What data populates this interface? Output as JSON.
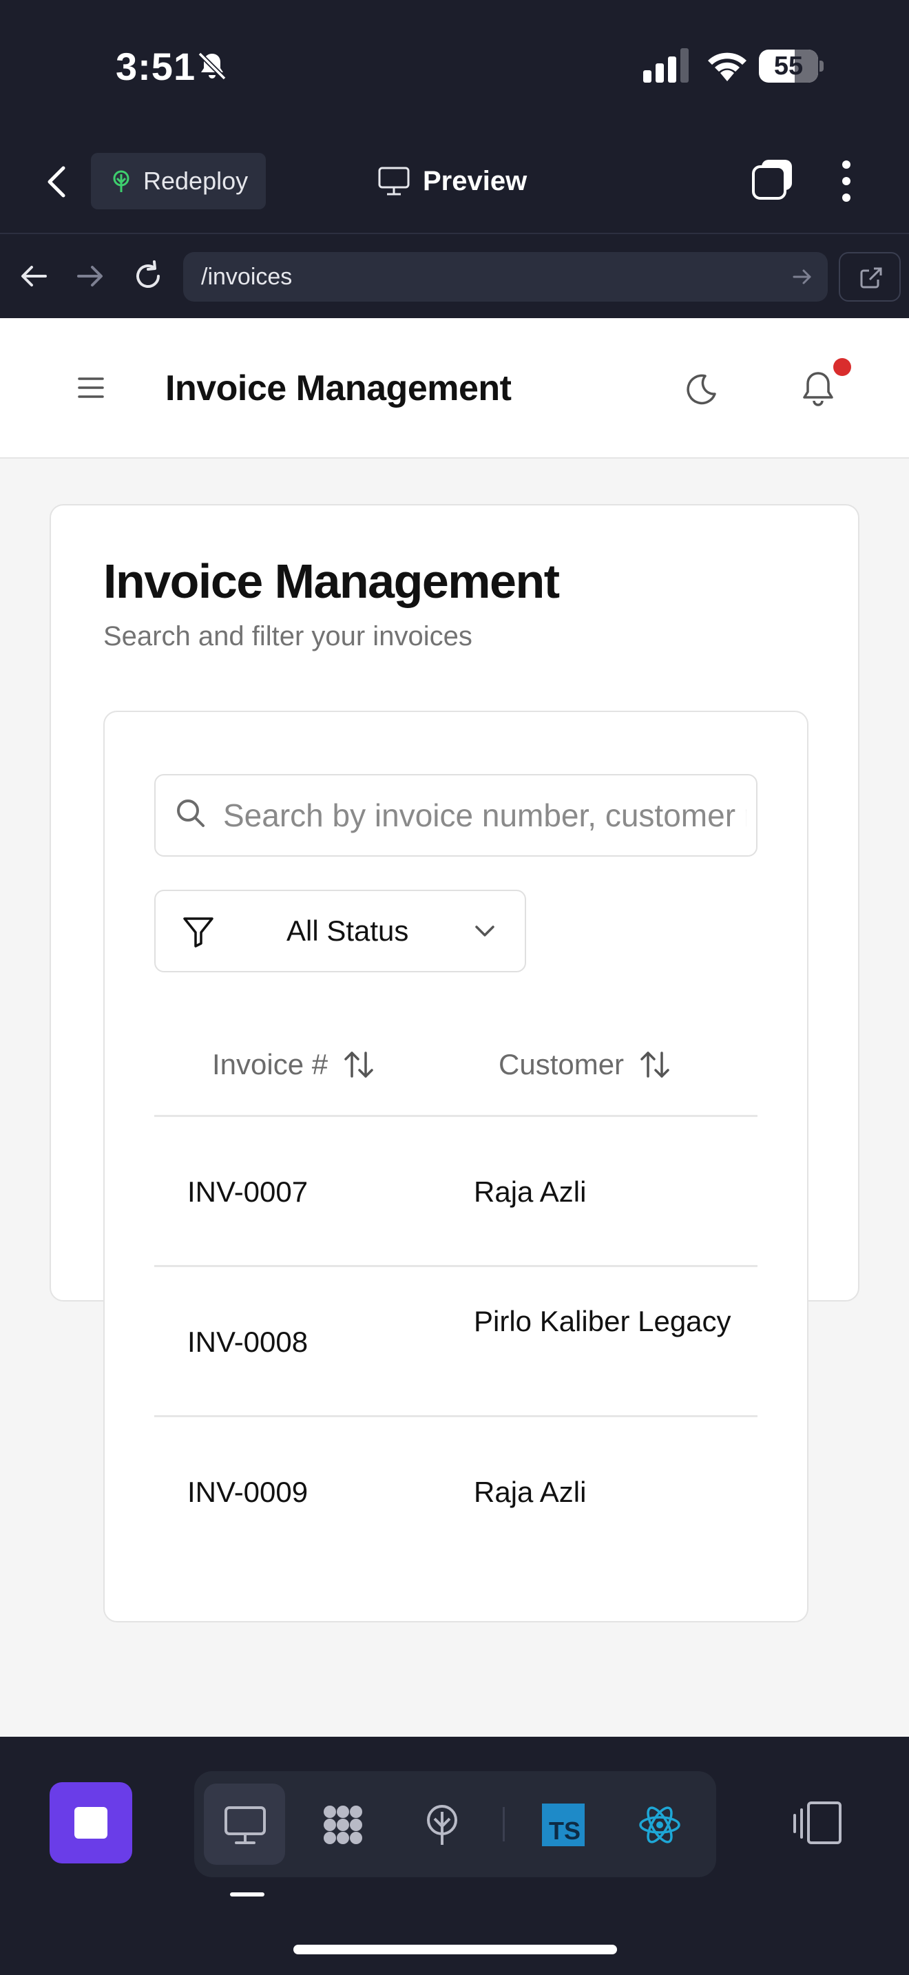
{
  "status_bar": {
    "time": "3:51",
    "battery": "55"
  },
  "app_header": {
    "redeploy_label": "Redeploy",
    "preview_label": "Preview"
  },
  "browser": {
    "url": "/invoices"
  },
  "topbar": {
    "title": "Invoice Management"
  },
  "page": {
    "title": "Invoice Management",
    "subtitle": "Search and filter your invoices"
  },
  "search": {
    "placeholder": "Search by invoice number, customer name..."
  },
  "status_filter": {
    "selected": "All Status"
  },
  "table": {
    "columns": [
      "Invoice #",
      "Customer"
    ],
    "rows": [
      {
        "invoice": "INV-0007",
        "customer": "Raja Azli"
      },
      {
        "invoice": "INV-0008",
        "customer": "Pirlo Kaliber Legacy"
      },
      {
        "invoice": "INV-0009",
        "customer": "Raja Azli"
      }
    ]
  },
  "colors": {
    "app_chrome": "#1c1e2b",
    "stop_button": "#6a3de8",
    "notification_dot": "#d92d2d",
    "redeploy_icon": "#3ecf6e",
    "react_icon": "#1ea7d6",
    "typescript_icon": "#1e8ac8"
  },
  "icons": {
    "status_bar": [
      "bell-muted-icon",
      "signal-icon",
      "wifi-icon",
      "battery-icon"
    ],
    "app_header": [
      "back-chevron-icon",
      "redeploy-tree-icon",
      "monitor-icon",
      "tabs-icon",
      "more-vertical-icon"
    ],
    "browser": [
      "arrow-left-icon",
      "arrow-right-icon",
      "reload-icon",
      "arrow-go-icon",
      "external-link-icon"
    ],
    "topbar": [
      "hamburger-icon",
      "moon-icon",
      "bell-icon"
    ],
    "content": [
      "search-icon",
      "filter-icon",
      "chevron-down-icon",
      "sort-icon"
    ],
    "dock": [
      "stop-icon",
      "monitor-icon",
      "nodes-icon",
      "deploy-tree-icon",
      "typescript-icon",
      "react-icon",
      "split-view-icon"
    ]
  }
}
